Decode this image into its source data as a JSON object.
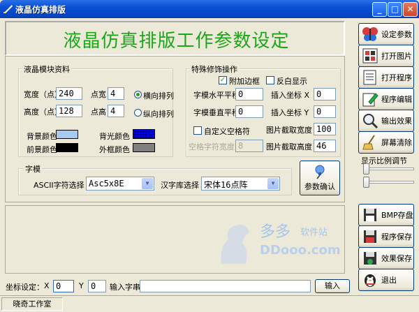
{
  "window": {
    "title": "液晶仿真排版",
    "minimize": "_",
    "maximize": "□",
    "close": "✕"
  },
  "header": {
    "title": "液晶仿真排版工作参数设定"
  },
  "lcd_module": {
    "group_label": "液晶模块资料",
    "width_label": "宽度（点）",
    "width_value": "240",
    "height_label": "高度（点）",
    "height_value": "128",
    "dot_width_label": "点宽",
    "dot_width_value": "4",
    "dot_height_label": "点高",
    "dot_height_value": "4",
    "horizontal_label": "横向排列",
    "vertical_label": "纵向排列",
    "bg_color_label": "背景颜色",
    "fg_color_label": "前景颜色",
    "backlight_label": "背光颜色",
    "frame_color_label": "外框颜色",
    "colors": {
      "bg": "#a6caf0",
      "fg": "#000000",
      "backlight": "#00008b",
      "frame": "#808080"
    }
  },
  "special": {
    "group_label": "特殊修饰操作",
    "add_border": "附加边框",
    "invert_display": "反白显示",
    "font_h_offset_label": "字模水平平移",
    "font_h_offset_value": "0",
    "font_v_offset_label": "字模垂直平移",
    "font_v_offset_value": "0",
    "insert_x_label": "插入坐标 X",
    "insert_x_value": "0",
    "insert_y_label": "插入坐标 Y",
    "insert_y_value": "0",
    "custom_space": "自定义空格符",
    "space_width_label": "空格字符宽度",
    "space_width_value": "8",
    "img_width_label": "图片截取宽度",
    "img_width_value": "100",
    "img_height_label": "图片截取高度",
    "img_height_value": "46"
  },
  "font": {
    "group_label": "字模",
    "ascii_label": "ASCII字符选择",
    "ascii_value": "Asc5x8E",
    "hz_label": "汉字库选择",
    "hz_value": "宋体16点阵",
    "confirm": "参数确认"
  },
  "sidebar": {
    "buttons": [
      {
        "label": "设定参数",
        "icon": "butterfly-icon"
      },
      {
        "label": "打开图片",
        "icon": "image-grid-icon"
      },
      {
        "label": "打开程序",
        "icon": "program-file-icon"
      },
      {
        "label": "程序编辑",
        "icon": "edit-pen-icon"
      },
      {
        "label": "输出效果",
        "icon": "magnifier-icon"
      },
      {
        "label": "屏幕清除",
        "icon": "broom-icon"
      }
    ],
    "scale_label": "显示比例调节",
    "bottom_buttons": [
      {
        "label": "BMP存盘",
        "icon": "bmp-disk-icon"
      },
      {
        "label": "程序保存",
        "icon": "save-disk-icon"
      },
      {
        "label": "效果保存",
        "icon": "save-apple-icon"
      },
      {
        "label": "退出",
        "icon": "exit-penguin-icon"
      }
    ]
  },
  "bottom": {
    "coord_label": "坐标设定：",
    "x_label": "X",
    "x_value": "0",
    "y_label": "Y",
    "y_value": "0",
    "input_label": "输入字串",
    "input_value": "",
    "input_button": "输入"
  },
  "status": {
    "text": "晓奇工作室"
  },
  "watermark": {
    "line1": "多多",
    "line2": "软件站",
    "line3": "DDooo.com"
  }
}
